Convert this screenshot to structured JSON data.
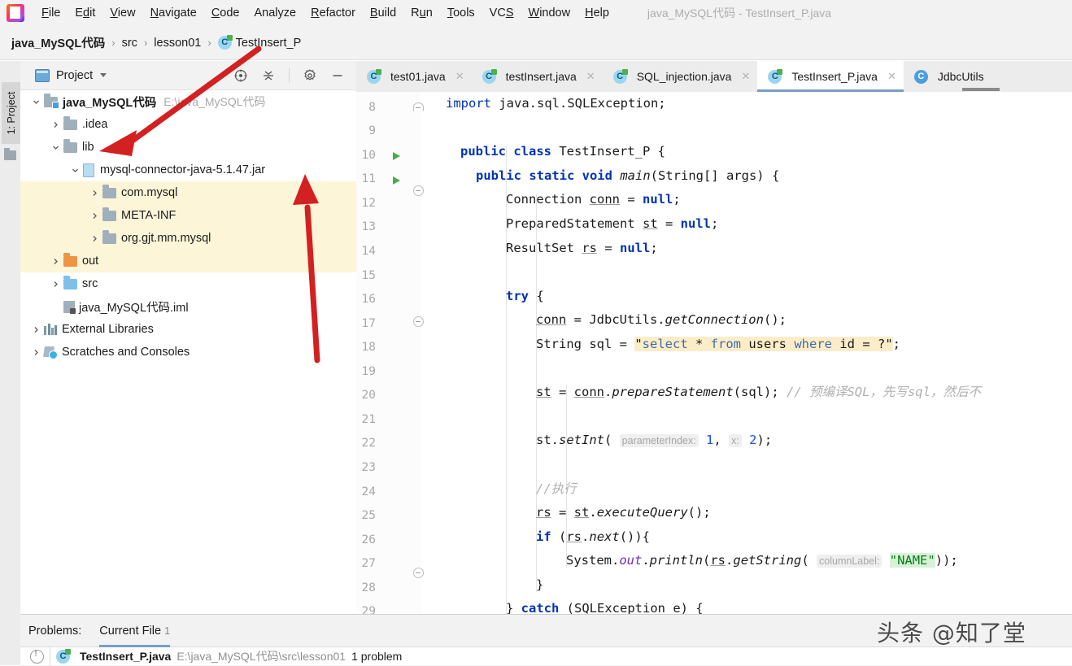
{
  "window": {
    "title": "java_MySQL代码 - TestInsert_P.java",
    "logo_icon": "intellij-idea-logo"
  },
  "menubar": {
    "items": [
      {
        "label": "File"
      },
      {
        "label": "Edit"
      },
      {
        "label": "View"
      },
      {
        "label": "Navigate"
      },
      {
        "label": "Code"
      },
      {
        "label": "Analyze"
      },
      {
        "label": "Refactor"
      },
      {
        "label": "Build"
      },
      {
        "label": "Run"
      },
      {
        "label": "Tools"
      },
      {
        "label": "VCS"
      },
      {
        "label": "Window"
      },
      {
        "label": "Help"
      }
    ]
  },
  "breadcrumb": {
    "items": [
      "java_MySQL代码",
      "src",
      "lesson01",
      "TestInsert_P"
    ],
    "separator": "›"
  },
  "toolstrip": {
    "project_tab_label": "1: Project"
  },
  "project_panel": {
    "title": "Project",
    "tools": [
      {
        "name": "locate-icon",
        "label": "Select Opened File"
      },
      {
        "name": "collapse-all-icon",
        "label": "Collapse All"
      },
      {
        "name": "gear-icon",
        "label": "Settings"
      },
      {
        "name": "minimize-icon",
        "label": "Hide"
      }
    ],
    "tree": [
      {
        "label": "java_MySQL代码",
        "path": "E:\\java_MySQL代码",
        "icon": "module-folder-icon",
        "indent": 0,
        "expanded": true,
        "bold": true,
        "highlight": false
      },
      {
        "label": ".idea",
        "path": "",
        "icon": "folder-icon",
        "indent": 1,
        "expanded": false,
        "bold": false,
        "highlight": false
      },
      {
        "label": "lib",
        "path": "",
        "icon": "folder-icon",
        "indent": 1,
        "expanded": true,
        "bold": false,
        "highlight": false
      },
      {
        "label": "mysql-connector-java-5.1.47.jar",
        "path": "",
        "icon": "jar-icon",
        "indent": 2,
        "expanded": true,
        "bold": false,
        "highlight": false
      },
      {
        "label": "com.mysql",
        "path": "",
        "icon": "folder-icon",
        "indent": 3,
        "expanded": false,
        "bold": false,
        "highlight": true
      },
      {
        "label": "META-INF",
        "path": "",
        "icon": "folder-icon",
        "indent": 3,
        "expanded": false,
        "bold": false,
        "highlight": true
      },
      {
        "label": "org.gjt.mm.mysql",
        "path": "",
        "icon": "folder-icon",
        "indent": 3,
        "expanded": false,
        "bold": false,
        "highlight": true
      },
      {
        "label": "out",
        "path": "",
        "icon": "folder-orange-icon",
        "indent": 1,
        "expanded": false,
        "bold": false,
        "highlight": true
      },
      {
        "label": "src",
        "path": "",
        "icon": "folder-blue-icon",
        "indent": 1,
        "expanded": false,
        "bold": false,
        "highlight": false
      },
      {
        "label": "java_MySQL代码.iml",
        "path": "",
        "icon": "iml-file-icon",
        "indent": 1,
        "expanded": null,
        "bold": false,
        "highlight": false
      },
      {
        "label": "External Libraries",
        "path": "",
        "icon": "libraries-icon",
        "indent": 0,
        "expanded": false,
        "bold": false,
        "highlight": false
      },
      {
        "label": "Scratches and Consoles",
        "path": "",
        "icon": "scratches-icon",
        "indent": 0,
        "expanded": false,
        "bold": false,
        "highlight": false
      }
    ]
  },
  "editor_tabs": {
    "items": [
      {
        "label": "test01.java",
        "icon": "java-class-icon",
        "active": false,
        "closable": true
      },
      {
        "label": "testInsert.java",
        "icon": "java-class-icon",
        "active": false,
        "closable": true
      },
      {
        "label": "SQL_injection.java",
        "icon": "java-class-icon",
        "active": false,
        "closable": true
      },
      {
        "label": "TestInsert_P.java",
        "icon": "java-class-icon",
        "active": true,
        "closable": true
      },
      {
        "label": "JdbcUtils",
        "icon": "java-class-plain-icon",
        "active": false,
        "closable": false
      }
    ]
  },
  "editor": {
    "first_line_number": 8,
    "line_numbers": [
      8,
      9,
      10,
      11,
      12,
      13,
      14,
      15,
      16,
      17,
      18,
      19,
      20,
      21,
      22,
      23,
      24,
      25,
      26,
      27,
      28,
      29
    ],
    "lines": {
      "l8": "import java.sql.SQLException;",
      "l10": "public class TestInsert_P {",
      "l11": "public static void main(String[] args) {",
      "l12": "Connection conn = null;",
      "l13": "PreparedStatement st = null;",
      "l14": "ResultSet rs = null;",
      "l16": "try {",
      "l17": "conn = JdbcUtils.getConnection();",
      "l18_prefix": "String sql = \"",
      "l18_sql": "select * from users where id = ?",
      "l18_suffix": "\";",
      "l20": "st = conn.prepareStatement(sql);",
      "l20_comment": "// 预编译SQL，先写sql，然后不",
      "l22_a": "st.setInt(",
      "l22_hint1": "parameterIndex:",
      "l22_v1": "1",
      "l22_hint2": "x:",
      "l22_v2": "2",
      "l22_b": ");",
      "l24": "//执行",
      "l25": "rs = st.executeQuery();",
      "l26": "if (rs.next()){",
      "l27_a": "System.out.println(rs.getString(",
      "l27_hint": "columnLabel:",
      "l27_str": "\"NAME\"",
      "l27_b": "));",
      "l28": "}",
      "l29": "} catch (SQLException e) {"
    },
    "run_markers_on_lines": [
      10,
      11
    ]
  },
  "problems_panel": {
    "label": "Problems:",
    "tab": "Current File",
    "tab_count": "1",
    "row": {
      "file": "TestInsert_P.java",
      "path": "E:\\java_MySQL代码\\src\\lesson01",
      "message": "1 problem",
      "icon": "warning-icon"
    }
  },
  "watermark": {
    "text": "头条 @知了堂"
  },
  "colors": {
    "accent": "#7a9cc6",
    "annotation_red": "#d32020",
    "highlight_yellow": "#fdf5d8",
    "string_green": "#067d17",
    "keyword_blue": "#0033b3"
  },
  "annotations": [
    {
      "name": "arrow-to-lib",
      "target": "lib"
    },
    {
      "name": "arrow-to-jar",
      "target": "mysql-connector-java-5.1.47.jar"
    }
  ]
}
